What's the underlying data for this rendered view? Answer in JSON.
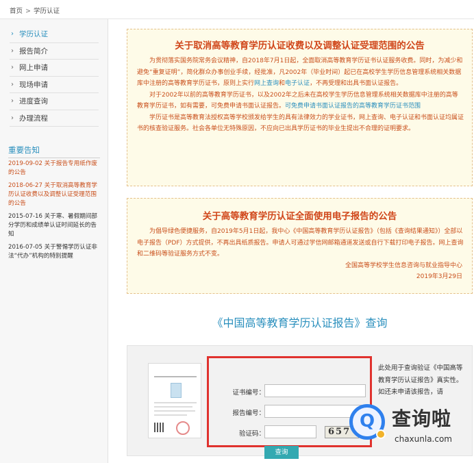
{
  "breadcrumb": {
    "home": "首页",
    "separator": ">",
    "current": "学历认证"
  },
  "sidebar": {
    "items": [
      {
        "label": "学历认证",
        "active": true
      },
      {
        "label": "报告简介",
        "active": false
      },
      {
        "label": "网上申请",
        "active": false
      },
      {
        "label": "现场申请",
        "active": false
      },
      {
        "label": "进度查询",
        "active": false
      },
      {
        "label": "办理流程",
        "active": false
      }
    ],
    "chevron_icon": "chevron-right-icon",
    "notices_title": "重要告知",
    "notices": [
      {
        "text": "2019-09-02 关于报告专用纸作废的公告",
        "highlight": true
      },
      {
        "text": "2018-06-27 关于取消高等教育学历认证收费以及调整认证受理范围的公告",
        "highlight": true
      },
      {
        "text": "2015-07-16 关于寒、暑假期间部分学历和成绩单认证时间延长的告知",
        "highlight": false
      },
      {
        "text": "2016-07-05 关于警惕学历认证非法“代办”机构的特别提醒",
        "highlight": false
      }
    ]
  },
  "announcement1": {
    "title": "关于取消高等教育学历认证收费以及调整认证受理范围的公告",
    "p1": {
      "before": "为贯彻落实国务院常务会议精神，自2018年7月1日起，全面取消高等教育学历证书认证服务收费。同时，为减少和避免“重复证明”，简化群众办事创业手续，经批准，凡2002年（毕业时间）起已在高校学生学历信息管理系统相关数据库中注册的高等教育学历证书，原则上实行",
      "link1": "网上查询",
      "mid": "和",
      "link2": "电子认证",
      "after": "，不再受理和出具书面认证报告。"
    },
    "p2": {
      "before": "对于2002年以前的高等教育学历证书，以及2002年之后未在高校学生学历信息管理系统相关数据库中注册的高等教育学历证书，如有需要，可免费申请书面认证报告。",
      "link": "可免费申请书面认证报告的高等教育学历证书范围"
    },
    "p3": "学历证书是高等教育法授权高等学校颁发给学生的具有法律效力的学业证书，网上查询、电子认证和书面认证均属证书的核查验证服务。社会各单位无特殊原因，不应向已出具学历证书的毕业生提出不合理的证明要求。"
  },
  "announcement2": {
    "title": "关于高等教育学历认证全面使用电子报告的公告",
    "body": "为倡导绿色便捷服务，自2019年5月1日起，我中心《中国高等教育学历认证报告》（包括《查询结果通知》）全部以电子报告（PDF）方式提供，不再出具纸质报告。申请人可通过学信网邮箱通道发送或自行下载打印电子报告。网上查询和二维码等验证服务方式不变。",
    "signature": "全国高等学校学生信息咨询与就业指导中心",
    "date": "2019年3月29日"
  },
  "query": {
    "title": "《中国高等教育学历认证报告》查询",
    "certificate_label": "证书编号：",
    "certificate_value": "",
    "report_label": "报告编号：",
    "report_value": "",
    "captcha_label": "验证码：",
    "captcha_value": "",
    "captcha_image_text": "657",
    "submit_label": "查询",
    "side_text": "此处用于查询验证《中国高等教育学历认证报告》真实性。如还未申请该报告，请"
  },
  "watermark": {
    "text": "查询啦",
    "url": "chaxunla.com",
    "icon": "magnifier-q-icon"
  },
  "colors": {
    "accent": "#2a8fbd",
    "notice_text": "#c94f1b",
    "notice_title": "#d0461a",
    "notice_bg": "#fefbe8",
    "button": "#33a9b1",
    "red_frame": "#e0322e"
  }
}
